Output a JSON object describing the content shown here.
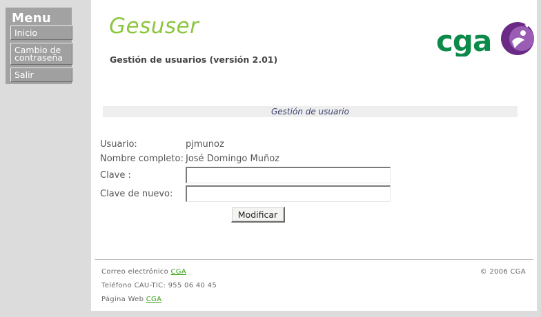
{
  "menu": {
    "title": "Menu",
    "items": [
      {
        "label": "Inicio"
      },
      {
        "label": "Cambio de contraseña"
      },
      {
        "label": "Salir"
      }
    ]
  },
  "header": {
    "app_title": "Gesuser",
    "subtitle": "Gestión de usuarios (versión 2.01)",
    "logo_text": "cga"
  },
  "section": {
    "title": "Gestión de usuario"
  },
  "form": {
    "usuario_label": "Usuario:",
    "usuario_value": "pjmunoz",
    "nombre_label": "Nombre completo:",
    "nombre_value": "José Domingo Muñoz",
    "clave_label": "Clave :",
    "clave_value": "",
    "clave2_label": "Clave de nuevo:",
    "clave2_value": "",
    "submit_label": "Modificar"
  },
  "footer": {
    "email_label": "Correo electrónico",
    "email_link": "CGA",
    "phone": "Teléfono CAU-TIC: 955 06 40 45",
    "web_label": "Página Web",
    "web_link": "CGA",
    "copyright": "© 2006 CGA"
  },
  "colors": {
    "brand_green": "#8cc63f",
    "logo_green": "#0b8a4a",
    "logo_purple": "#6b2a86",
    "menu_gray": "#a2a2a2",
    "link_green": "#37a018"
  },
  "icons": [
    "cga-logo"
  ]
}
